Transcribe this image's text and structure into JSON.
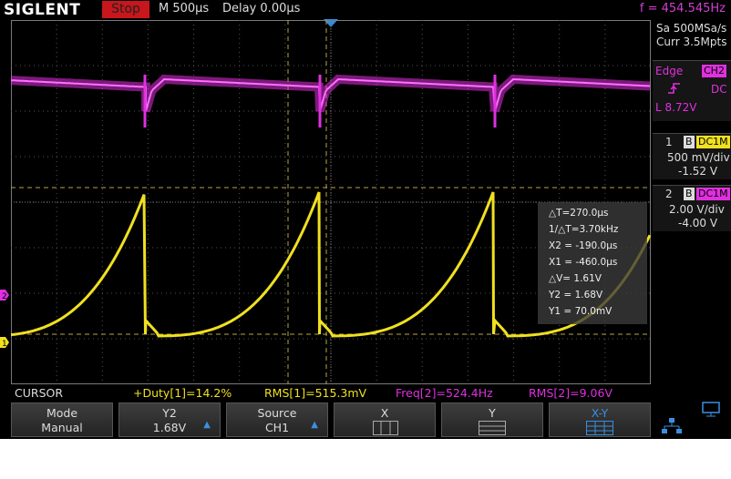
{
  "header": {
    "brand": "SIGLENT",
    "run_state": "Stop",
    "timebase": "M 500µs",
    "delay": "Delay 0.00µs",
    "frequency": "f = 454.545Hz"
  },
  "acquisition": {
    "sample_rate": "Sa 500MSa/s",
    "memory": "Curr 3.5Mpts"
  },
  "trigger": {
    "type": "Edge",
    "source": "CH2",
    "coupling": "DC",
    "level": "L  8.72V"
  },
  "channel1": {
    "number": "1",
    "bw_icon": "B",
    "coupling": "DC1M",
    "scale": "500 mV/div",
    "offset": "-1.52 V",
    "color": "#f0e020"
  },
  "channel2": {
    "number": "2",
    "bw_icon": "B",
    "coupling": "DC1M",
    "scale": "2.00 V/div",
    "offset": "-4.00 V",
    "color": "#e030e0"
  },
  "cursor_readout": {
    "dt": "△T=270.0µs",
    "inv_dt": "1/△T=3.70kHz",
    "x2": "X2 = -190.0µs",
    "x1": "X1 = -460.0µs",
    "dv": "△V= 1.61V",
    "y2": "Y2 = 1.68V",
    "y1": "Y1 = 70.0mV"
  },
  "measurements": {
    "label": "CURSOR",
    "duty": "+Duty[1]=14.2%",
    "rms1": "RMS[1]=515.3mV",
    "freq2": "Freq[2]=524.4Hz",
    "rms2": "RMS[2]=9.06V"
  },
  "softkeys": [
    {
      "top": "Mode",
      "bottom": "Manual"
    },
    {
      "top": "Y2",
      "bottom": "1.68V"
    },
    {
      "top": "Source",
      "bottom": "CH1"
    },
    {
      "top": "X",
      "bottom": ""
    },
    {
      "top": "Y",
      "bottom": ""
    },
    {
      "top": "X-Y",
      "bottom": ""
    }
  ],
  "icons": {
    "trigger_position": "triangle-down-icon",
    "trigger_edge": "rising-edge-icon",
    "bandwidth": "bandwidth-limit-icon",
    "network": "network-icon",
    "display": "monitor-icon"
  }
}
